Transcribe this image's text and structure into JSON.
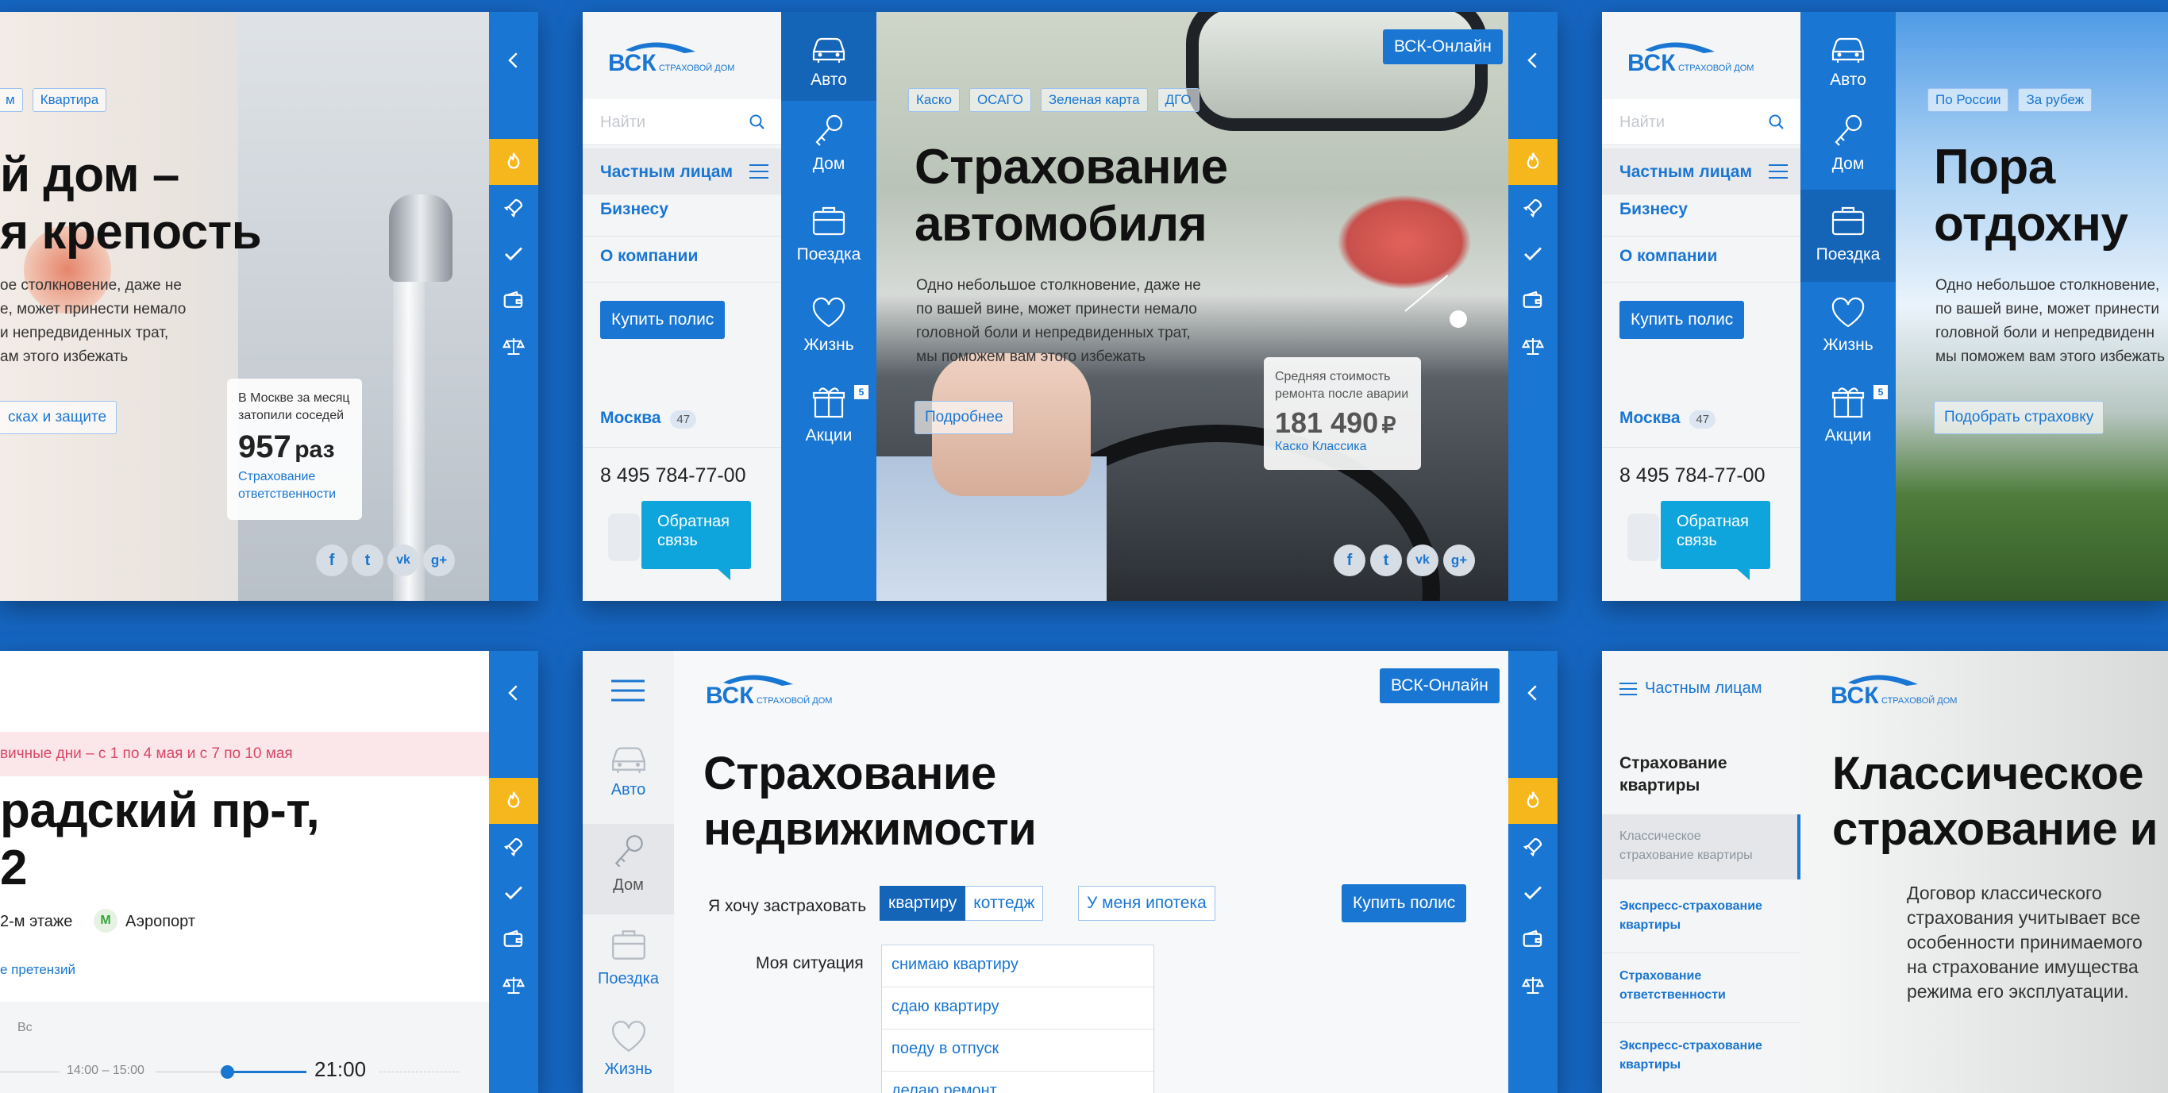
{
  "brand": {
    "logo_main": "ВСК",
    "logo_sub": "СТРАХОВОЙ ДОМ",
    "online_button": "ВСК-Онлайн"
  },
  "colors": {
    "primary": "#1976d2",
    "accent": "#f5b71c",
    "background": "#1565c0",
    "light": "#f4f5f6"
  },
  "nav": {
    "search_placeholder": "Найти",
    "sections": [
      "Частным лицам",
      "Бизнесу",
      "О компании"
    ],
    "buy_button": "Купить полис",
    "city": "Москва",
    "city_count": "47",
    "phone": "8 495 784-77-00",
    "feedback": "Обратная связь",
    "categories": [
      "Авто",
      "Дом",
      "Поездка",
      "Жизнь",
      "Акции"
    ],
    "promo_badge": "5"
  },
  "icons": [
    "fire-icon",
    "rocket-icon",
    "check-icon",
    "wallet-icon",
    "scales-icon",
    "chevron-left-icon",
    "search-icon",
    "menu-icon"
  ],
  "panel1": {
    "tag": "Квартира",
    "title_line1": "й дом –",
    "title_line2": "я крепость",
    "desc": [
      "ое столкновение, даже не",
      "е, может принести немало",
      "и непредвиденных трат,",
      "ам этого избежать"
    ],
    "button": "сках и защите",
    "stat_label": "В Москве за месяц затопили соседей",
    "stat_value": "957",
    "stat_unit": "раз",
    "stat_link": "Страхование ответственности",
    "social": [
      "f",
      "t",
      "vk",
      "g+"
    ]
  },
  "panel2": {
    "tags": [
      "Каско",
      "ОСАГО",
      "Зеленая карта",
      "ДГО"
    ],
    "title_line1": "Страхование",
    "title_line2": "автомобиля",
    "desc": [
      "Одно небольшое столкновение, даже не",
      "по вашей вине, может принести немало",
      "головной боли и непредвиденных трат,",
      "мы поможем вам этого избежать"
    ],
    "button": "Подробнее",
    "stat_label": "Средняя стоимость ремонта после аварии",
    "stat_value": "181 490",
    "stat_currency": "₽",
    "stat_link": "Каско Классика"
  },
  "panel3": {
    "tags": [
      "По России",
      "За рубеж"
    ],
    "title_line1": "Пора",
    "title_line2": "отдохну",
    "desc": [
      "Одно небольшое столкновение,",
      "по вашей вине, может принести",
      "головной боли и непредвиденн",
      "мы поможем вам этого избежать"
    ],
    "button": "Подобрать страховку"
  },
  "panel4": {
    "notice": "вичные дни – с 1 по 4 мая и с 7 по 10 мая",
    "title_line1": "радский пр-т,",
    "title_line2": "2",
    "floor": "2-м этаже",
    "metro_icon": "М",
    "metro": "Аэропорт",
    "link": "е претензий",
    "day": "Вс",
    "hours": "14:00 – 15:00",
    "time": "21:00"
  },
  "panel5": {
    "categories": [
      "Авто",
      "Дом",
      "Поездка",
      "Жизнь"
    ],
    "title_line1": "Страхование",
    "title_line2": "недвижимости",
    "want_label": "Я хочу застраховать",
    "seg_active": "квартиру",
    "seg_other": "коттедж",
    "mortgage": "У меня ипотека",
    "buy_button": "Купить полис",
    "situation_label": "Моя ситуация",
    "situations": [
      "снимаю квартиру",
      "сдаю квартиру",
      "поеду в отпуск",
      "делаю ремонт"
    ]
  },
  "panel6": {
    "menu_label": "Частным лицам",
    "side_title": "Страхование квартиры",
    "side_items": [
      "Классическое страхование квартиры",
      "Экспресс-страхование квартиры",
      "Страхование ответственности",
      "Экспресс-страхование квартиры"
    ],
    "title_line1": "Классическое",
    "title_line2": "страхование и",
    "desc": [
      "Договор классического",
      "страхования учитывает все",
      "особенности принимаемого",
      "на страхование имущества",
      "режима его эксплуатации."
    ]
  }
}
